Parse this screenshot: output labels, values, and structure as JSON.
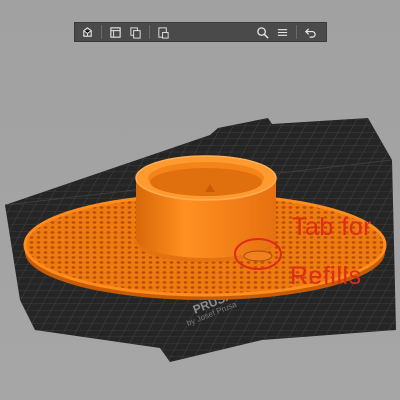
{
  "window": {
    "title": ""
  },
  "toolbar": {
    "buttons": [
      {
        "icon": "add-object-icon"
      },
      {
        "icon": "arrange-icon"
      },
      {
        "icon": "copy-icon"
      },
      {
        "icon": "paste-icon"
      },
      {
        "icon": "search-icon"
      },
      {
        "icon": "layers-icon"
      },
      {
        "icon": "undo-icon"
      }
    ]
  },
  "plate": {
    "brand_line1": "PRUSA i3 MK3",
    "brand_line2": "by Josef Prusa"
  },
  "annotation": {
    "line1": "Tab for",
    "line2": "Refills"
  },
  "colors": {
    "model": "#ff8a1a",
    "model_shadow": "#cf5f08",
    "bed": "#2a2a2a",
    "annotation": "#e02a1a",
    "background": "#a3a3a3"
  }
}
